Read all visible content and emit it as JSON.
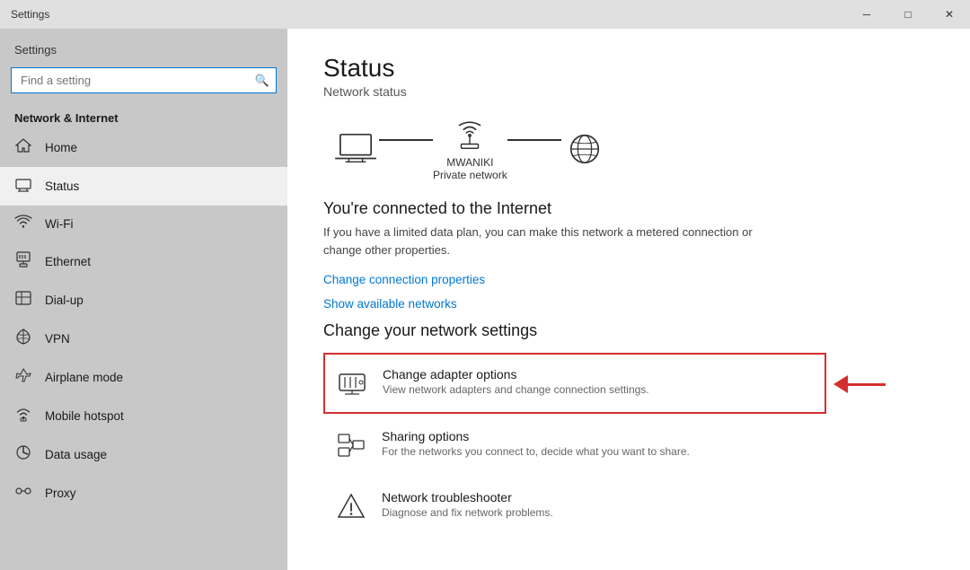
{
  "titlebar": {
    "title": "Settings",
    "min_label": "─",
    "max_label": "□",
    "close_label": "✕"
  },
  "sidebar": {
    "header": "Settings",
    "search_placeholder": "Find a setting",
    "section_label": "Network & Internet",
    "nav_items": [
      {
        "id": "home",
        "icon": "⌂",
        "label": "Home"
      },
      {
        "id": "status",
        "icon": "≡",
        "label": "Status",
        "active": true
      },
      {
        "id": "wifi",
        "icon": "wifi",
        "label": "Wi-Fi"
      },
      {
        "id": "ethernet",
        "icon": "ethernet",
        "label": "Ethernet"
      },
      {
        "id": "dialup",
        "icon": "dialup",
        "label": "Dial-up"
      },
      {
        "id": "vpn",
        "icon": "vpn",
        "label": "VPN"
      },
      {
        "id": "airplane",
        "icon": "airplane",
        "label": "Airplane mode"
      },
      {
        "id": "hotspot",
        "icon": "hotspot",
        "label": "Mobile hotspot"
      },
      {
        "id": "datausage",
        "icon": "datausage",
        "label": "Data usage"
      },
      {
        "id": "proxy",
        "icon": "proxy",
        "label": "Proxy"
      }
    ]
  },
  "content": {
    "title": "Status",
    "subtitle": "Network status",
    "network": {
      "device_label": "MWANIKI",
      "device_sublabel": "Private network"
    },
    "connected_title": "You're connected to the Internet",
    "connected_desc": "If you have a limited data plan, you can make this network a metered connection or change other properties.",
    "link_change": "Change connection properties",
    "link_available": "Show available networks",
    "change_settings_title": "Change your network settings",
    "settings_items": [
      {
        "id": "adapter",
        "title": "Change adapter options",
        "desc": "View network adapters and change connection settings.",
        "highlighted": true
      },
      {
        "id": "sharing",
        "title": "Sharing options",
        "desc": "For the networks you connect to, decide what you want to share."
      },
      {
        "id": "troubleshooter",
        "title": "Network troubleshooter",
        "desc": "Diagnose and fix network problems."
      }
    ]
  },
  "colors": {
    "accent": "#0078d4",
    "sidebar_bg": "#c8c8c8",
    "active_bg": "#f0f0f0",
    "highlight_border": "#d32f2f",
    "arrow_color": "#d32f2f"
  }
}
